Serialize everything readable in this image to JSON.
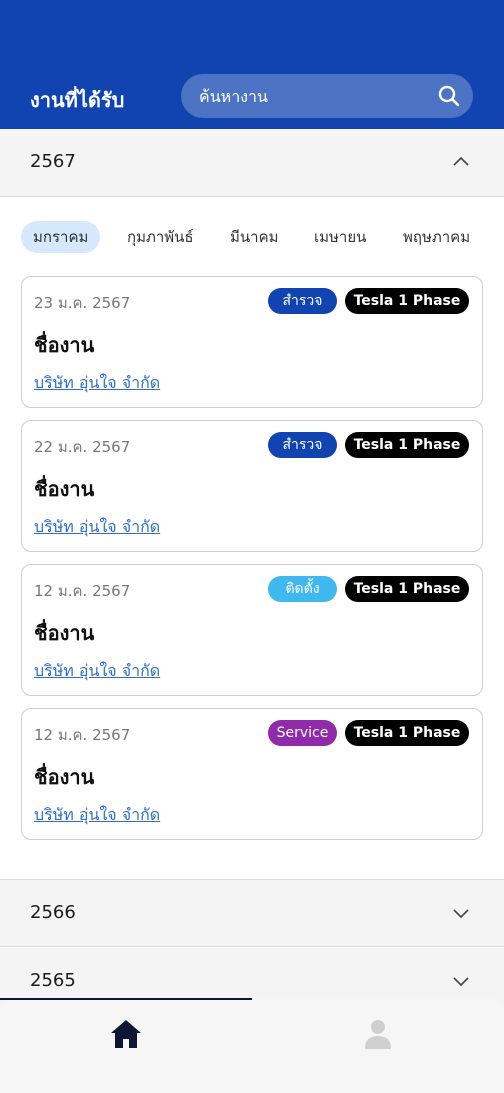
{
  "header": {
    "title": "งานที่ได้รับ",
    "search_placeholder": "ค้นหางาน"
  },
  "years": [
    {
      "label": "2567",
      "expanded": true
    },
    {
      "label": "2566",
      "expanded": false
    },
    {
      "label": "2565",
      "expanded": false
    }
  ],
  "months": [
    "มกราคม",
    "กุมภาพันธ์",
    "มีนาคม",
    "เมษายน",
    "พฤษภาคม"
  ],
  "active_month": "มกราคม",
  "jobs": [
    {
      "date": "23 ม.ค. 2567",
      "type": "สำรวจ",
      "type_color": "#1144b0",
      "model": "Tesla 1 Phase",
      "title": "ชื่องาน",
      "company": "บริษัท อุ่นใจ จำกัด"
    },
    {
      "date": "22 ม.ค. 2567",
      "type": "สำรวจ",
      "type_color": "#1144b0",
      "model": "Tesla 1 Phase",
      "title": "ชื่องาน",
      "company": "บริษัท อุ่นใจ จำกัด"
    },
    {
      "date": "12 ม.ค. 2567",
      "type": "ติดตั้ง",
      "type_color": "#3fb8ef",
      "model": "Tesla 1 Phase",
      "title": "ชื่องาน",
      "company": "บริษัท อุ่นใจ จำกัด"
    },
    {
      "date": "12 ม.ค. 2567",
      "type": "Service",
      "type_color": "#8f2aa8",
      "model": "Tesla 1 Phase",
      "title": "ชื่องาน",
      "company": "บริษัท อุ่นใจ จำกัด"
    }
  ],
  "nav": {
    "items": [
      {
        "icon": "home-icon",
        "active": true
      },
      {
        "icon": "profile-icon",
        "active": false
      }
    ]
  }
}
